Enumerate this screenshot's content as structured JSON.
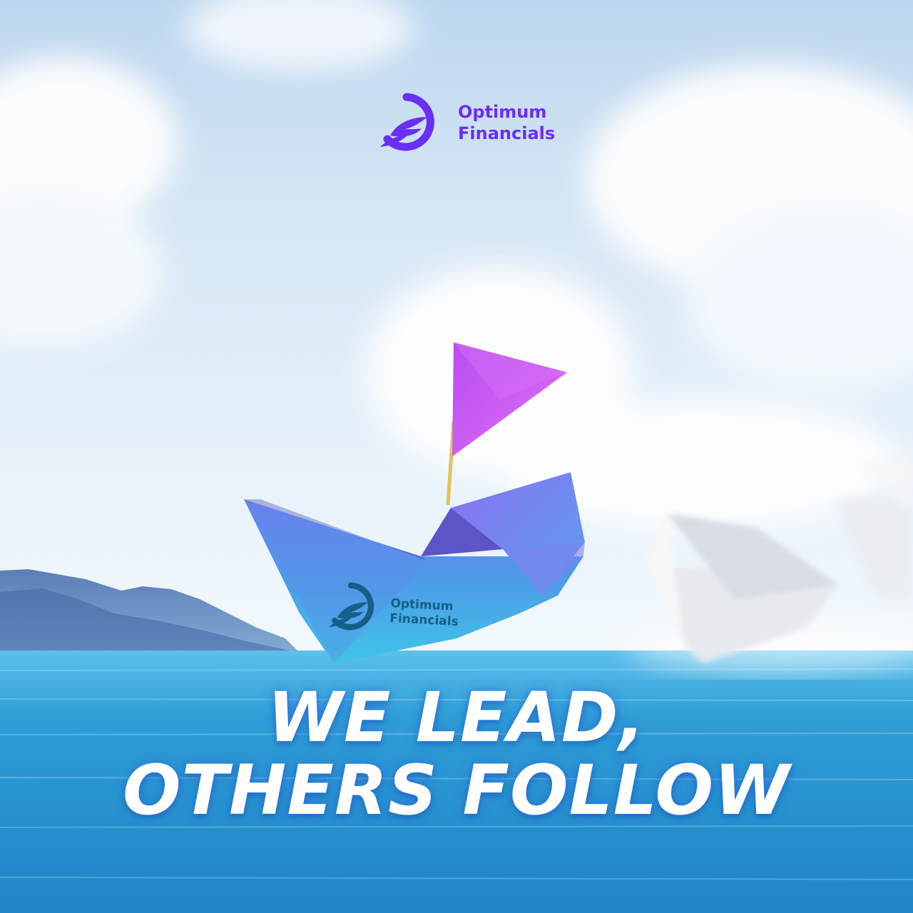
{
  "brand": {
    "line1": "Optimum",
    "line2": "Financials",
    "color": "#6a2ef5"
  },
  "boat_brand": {
    "line1": "Optimum",
    "line2": "Financials",
    "color": "#155f88"
  },
  "headline": {
    "line1": "WE LEAD,",
    "line2": "OTHERS FOLLOW"
  },
  "colors": {
    "sky_top": "#c9dff2",
    "sea": "#2e9bd6",
    "boat_blue": "#5b8df0",
    "flag": "#c550f0"
  }
}
